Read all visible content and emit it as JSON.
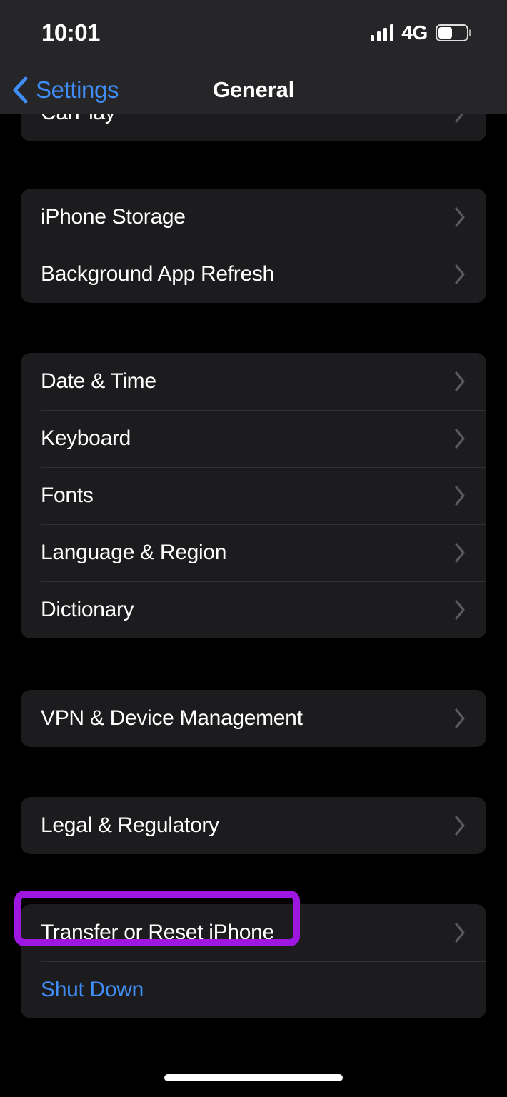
{
  "status_bar": {
    "time": "10:01",
    "signal_icon": "cellular-signal-icon",
    "signal_bars_filled": 4,
    "carrier_tech": "4G",
    "battery_icon": "battery-icon",
    "battery_percent": 50
  },
  "nav": {
    "back_label": "Settings",
    "back_icon": "chevron-left-icon",
    "title": "General"
  },
  "colors": {
    "page_background": "#000000",
    "card_background": "#1c1c1e",
    "header_background": "#262628",
    "accent_blue": "#3f8df5",
    "highlight_purple": "#9d17e0",
    "separator": "#313133",
    "chevron_gray": "#5b5b5e"
  },
  "groups": [
    {
      "name": "carplay-group",
      "rows": [
        {
          "label": "CarPlay",
          "accent": false,
          "chevron": true
        }
      ]
    },
    {
      "name": "storage-group",
      "rows": [
        {
          "label": "iPhone Storage",
          "accent": false,
          "chevron": true
        },
        {
          "label": "Background App Refresh",
          "accent": false,
          "chevron": true
        }
      ]
    },
    {
      "name": "localization-group",
      "rows": [
        {
          "label": "Date & Time",
          "accent": false,
          "chevron": true
        },
        {
          "label": "Keyboard",
          "accent": false,
          "chevron": true
        },
        {
          "label": "Fonts",
          "accent": false,
          "chevron": true
        },
        {
          "label": "Language & Region",
          "accent": false,
          "chevron": true
        },
        {
          "label": "Dictionary",
          "accent": false,
          "chevron": true
        }
      ]
    },
    {
      "name": "vpn-group",
      "rows": [
        {
          "label": "VPN & Device Management",
          "accent": false,
          "chevron": true
        }
      ]
    },
    {
      "name": "legal-group",
      "rows": [
        {
          "label": "Legal & Regulatory",
          "accent": false,
          "chevron": true
        }
      ]
    },
    {
      "name": "reset-group",
      "rows": [
        {
          "label": "Transfer or Reset iPhone",
          "accent": false,
          "chevron": true
        },
        {
          "label": "Shut Down",
          "accent": true,
          "chevron": false
        }
      ]
    }
  ],
  "annotation": {
    "target_label": "Transfer or Reset iPhone",
    "shape": "rounded-rectangle-outline"
  },
  "home_indicator": "home-indicator"
}
